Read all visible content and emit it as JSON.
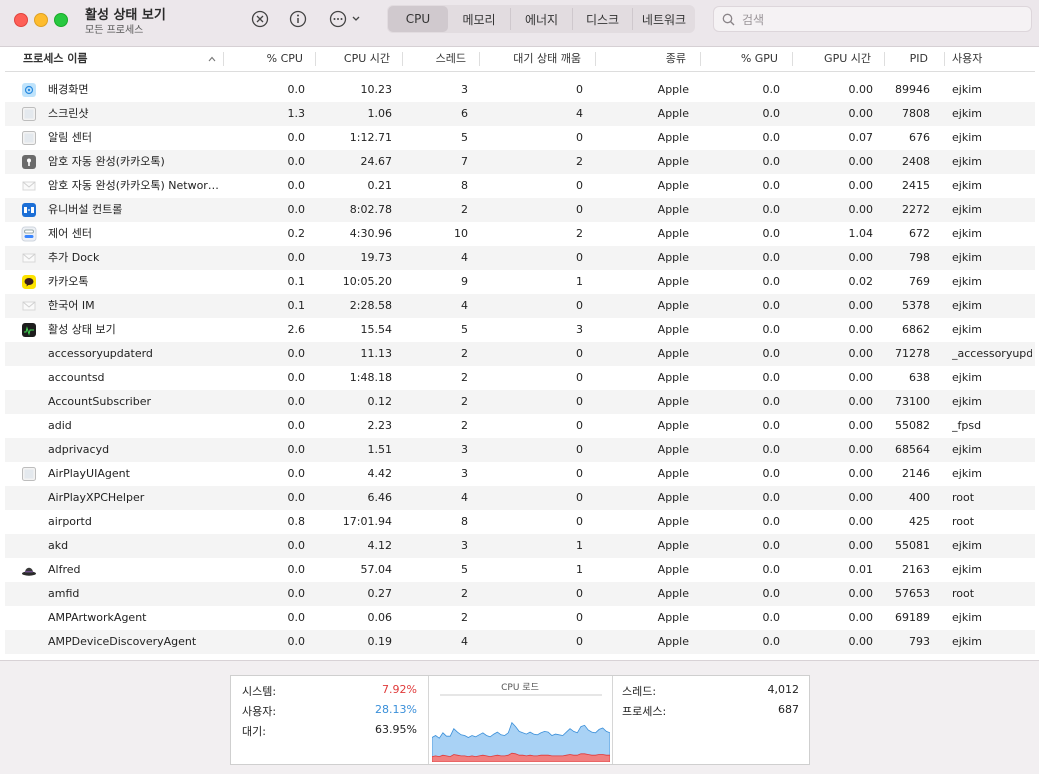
{
  "window": {
    "title": "활성 상태 보기",
    "subtitle": "모든 프로세스"
  },
  "toolbar": {
    "icons": [
      "close-circle-icon",
      "info-icon",
      "more-options-icon"
    ],
    "tabs": [
      "CPU",
      "메모리",
      "에너지",
      "디스크",
      "네트워크"
    ],
    "active_tab": "CPU",
    "search_placeholder": "검색"
  },
  "table": {
    "columns": [
      "프로세스 이름",
      "% CPU",
      "CPU 시간",
      "스레드",
      "대기 상태 깨움",
      "종류",
      "% GPU",
      "GPU 시간",
      "PID",
      "사용자"
    ],
    "sort_column": "프로세스 이름",
    "rows": [
      {
        "name": "배경화면",
        "cpu": "0.0",
        "cpu_time": "10.23",
        "threads": "3",
        "wakeups": "0",
        "kind": "Apple",
        "gpu": "0.0",
        "gpu_time": "0.00",
        "pid": "89946",
        "user": "ejkim",
        "icon": "wallpaper-icon"
      },
      {
        "name": "스크린샷",
        "cpu": "1.3",
        "cpu_time": "1.06",
        "threads": "6",
        "wakeups": "4",
        "kind": "Apple",
        "gpu": "0.0",
        "gpu_time": "0.00",
        "pid": "7808",
        "user": "ejkim",
        "icon": "generic-app-icon"
      },
      {
        "name": "알림 센터",
        "cpu": "0.0",
        "cpu_time": "1:12.71",
        "threads": "5",
        "wakeups": "0",
        "kind": "Apple",
        "gpu": "0.0",
        "gpu_time": "0.07",
        "pid": "676",
        "user": "ejkim",
        "icon": "generic-app-icon"
      },
      {
        "name": "암호 자동 완성(카카오톡)",
        "cpu": "0.0",
        "cpu_time": "24.67",
        "threads": "7",
        "wakeups": "2",
        "kind": "Apple",
        "gpu": "0.0",
        "gpu_time": "0.00",
        "pid": "2408",
        "user": "ejkim",
        "icon": "keyhole-icon"
      },
      {
        "name": "암호 자동 완성(카카오톡) Networ…",
        "cpu": "0.0",
        "cpu_time": "0.21",
        "threads": "8",
        "wakeups": "0",
        "kind": "Apple",
        "gpu": "0.0",
        "gpu_time": "0.00",
        "pid": "2415",
        "user": "ejkim",
        "icon": "envelope-icon"
      },
      {
        "name": "유니버설 컨트롤",
        "cpu": "0.0",
        "cpu_time": "8:02.78",
        "threads": "2",
        "wakeups": "0",
        "kind": "Apple",
        "gpu": "0.0",
        "gpu_time": "0.00",
        "pid": "2272",
        "user": "ejkim",
        "icon": "universal-control-icon"
      },
      {
        "name": "제어 센터",
        "cpu": "0.2",
        "cpu_time": "4:30.96",
        "threads": "10",
        "wakeups": "2",
        "kind": "Apple",
        "gpu": "0.0",
        "gpu_time": "1.04",
        "pid": "672",
        "user": "ejkim",
        "icon": "control-center-icon"
      },
      {
        "name": "추가 Dock",
        "cpu": "0.0",
        "cpu_time": "19.73",
        "threads": "4",
        "wakeups": "0",
        "kind": "Apple",
        "gpu": "0.0",
        "gpu_time": "0.00",
        "pid": "798",
        "user": "ejkim",
        "icon": "envelope-icon"
      },
      {
        "name": "카카오톡",
        "cpu": "0.1",
        "cpu_time": "10:05.20",
        "threads": "9",
        "wakeups": "1",
        "kind": "Apple",
        "gpu": "0.0",
        "gpu_time": "0.02",
        "pid": "769",
        "user": "ejkim",
        "icon": "kakaotalk-icon"
      },
      {
        "name": "한국어 IM",
        "cpu": "0.1",
        "cpu_time": "2:28.58",
        "threads": "4",
        "wakeups": "0",
        "kind": "Apple",
        "gpu": "0.0",
        "gpu_time": "0.00",
        "pid": "5378",
        "user": "ejkim",
        "icon": "envelope-icon"
      },
      {
        "name": "활성 상태 보기",
        "cpu": "2.6",
        "cpu_time": "15.54",
        "threads": "5",
        "wakeups": "3",
        "kind": "Apple",
        "gpu": "0.0",
        "gpu_time": "0.00",
        "pid": "6862",
        "user": "ejkim",
        "icon": "activity-monitor-icon"
      },
      {
        "name": "accessoryupdaterd",
        "cpu": "0.0",
        "cpu_time": "11.13",
        "threads": "2",
        "wakeups": "0",
        "kind": "Apple",
        "gpu": "0.0",
        "gpu_time": "0.00",
        "pid": "71278",
        "user": "_accessoryupd",
        "icon": ""
      },
      {
        "name": "accountsd",
        "cpu": "0.0",
        "cpu_time": "1:48.18",
        "threads": "2",
        "wakeups": "0",
        "kind": "Apple",
        "gpu": "0.0",
        "gpu_time": "0.00",
        "pid": "638",
        "user": "ejkim",
        "icon": ""
      },
      {
        "name": "AccountSubscriber",
        "cpu": "0.0",
        "cpu_time": "0.12",
        "threads": "2",
        "wakeups": "0",
        "kind": "Apple",
        "gpu": "0.0",
        "gpu_time": "0.00",
        "pid": "73100",
        "user": "ejkim",
        "icon": ""
      },
      {
        "name": "adid",
        "cpu": "0.0",
        "cpu_time": "2.23",
        "threads": "2",
        "wakeups": "0",
        "kind": "Apple",
        "gpu": "0.0",
        "gpu_time": "0.00",
        "pid": "55082",
        "user": "_fpsd",
        "icon": ""
      },
      {
        "name": "adprivacyd",
        "cpu": "0.0",
        "cpu_time": "1.51",
        "threads": "3",
        "wakeups": "0",
        "kind": "Apple",
        "gpu": "0.0",
        "gpu_time": "0.00",
        "pid": "68564",
        "user": "ejkim",
        "icon": ""
      },
      {
        "name": "AirPlayUIAgent",
        "cpu": "0.0",
        "cpu_time": "4.42",
        "threads": "3",
        "wakeups": "0",
        "kind": "Apple",
        "gpu": "0.0",
        "gpu_time": "0.00",
        "pid": "2146",
        "user": "ejkim",
        "icon": "generic-app-icon"
      },
      {
        "name": "AirPlayXPCHelper",
        "cpu": "0.0",
        "cpu_time": "6.46",
        "threads": "4",
        "wakeups": "0",
        "kind": "Apple",
        "gpu": "0.0",
        "gpu_time": "0.00",
        "pid": "400",
        "user": "root",
        "icon": ""
      },
      {
        "name": "airportd",
        "cpu": "0.8",
        "cpu_time": "17:01.94",
        "threads": "8",
        "wakeups": "0",
        "kind": "Apple",
        "gpu": "0.0",
        "gpu_time": "0.00",
        "pid": "425",
        "user": "root",
        "icon": ""
      },
      {
        "name": "akd",
        "cpu": "0.0",
        "cpu_time": "4.12",
        "threads": "3",
        "wakeups": "1",
        "kind": "Apple",
        "gpu": "0.0",
        "gpu_time": "0.00",
        "pid": "55081",
        "user": "ejkim",
        "icon": ""
      },
      {
        "name": "Alfred",
        "cpu": "0.0",
        "cpu_time": "57.04",
        "threads": "5",
        "wakeups": "1",
        "kind": "Apple",
        "gpu": "0.0",
        "gpu_time": "0.01",
        "pid": "2163",
        "user": "ejkim",
        "icon": "alfred-hat-icon"
      },
      {
        "name": "amfid",
        "cpu": "0.0",
        "cpu_time": "0.27",
        "threads": "2",
        "wakeups": "0",
        "kind": "Apple",
        "gpu": "0.0",
        "gpu_time": "0.00",
        "pid": "57653",
        "user": "root",
        "icon": ""
      },
      {
        "name": "AMPArtworkAgent",
        "cpu": "0.0",
        "cpu_time": "0.06",
        "threads": "2",
        "wakeups": "0",
        "kind": "Apple",
        "gpu": "0.0",
        "gpu_time": "0.00",
        "pid": "69189",
        "user": "ejkim",
        "icon": ""
      },
      {
        "name": "AMPDeviceDiscoveryAgent",
        "cpu": "0.0",
        "cpu_time": "0.19",
        "threads": "4",
        "wakeups": "0",
        "kind": "Apple",
        "gpu": "0.0",
        "gpu_time": "0.00",
        "pid": "793",
        "user": "ejkim",
        "icon": ""
      }
    ]
  },
  "summary": {
    "system_label": "시스템:",
    "system_value": "7.92%",
    "user_label": "사용자:",
    "user_value": "28.13%",
    "idle_label": "대기:",
    "idle_value": "63.95%",
    "cpu_load_title": "CPU 로드",
    "threads_label": "스레드:",
    "threads_value": "4,012",
    "processes_label": "프로세스:",
    "processes_value": "687"
  },
  "colors": {
    "system": "#e03a3a",
    "user": "#3a8fd9",
    "user_fill": "#a9d2f5",
    "system_fill": "#f08080"
  },
  "chart_data": {
    "type": "area",
    "title": "CPU 로드",
    "ylim": [
      0,
      100
    ],
    "series": [
      {
        "name": "사용자",
        "values": [
          28,
          30,
          27,
          33,
          29,
          30,
          38,
          34,
          31,
          30,
          28,
          30,
          29,
          31,
          33,
          30,
          29,
          32,
          34,
          31,
          30,
          33,
          45,
          40,
          35,
          33,
          32,
          34,
          32,
          31,
          33,
          35,
          34,
          30,
          32,
          31,
          30,
          34,
          38,
          35,
          33,
          40,
          42,
          36,
          34,
          33,
          37,
          39,
          35,
          33
        ]
      },
      {
        "name": "시스템",
        "values": [
          8,
          9,
          8,
          10,
          9,
          8,
          11,
          10,
          9,
          9,
          8,
          9,
          8,
          9,
          10,
          9,
          8,
          9,
          10,
          9,
          9,
          10,
          13,
          12,
          10,
          10,
          9,
          10,
          9,
          9,
          10,
          10,
          10,
          9,
          9,
          9,
          9,
          10,
          11,
          10,
          10,
          12,
          12,
          11,
          10,
          10,
          11,
          11,
          10,
          10
        ]
      }
    ]
  }
}
